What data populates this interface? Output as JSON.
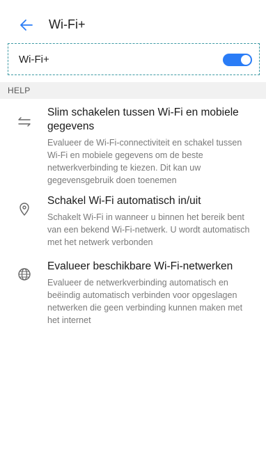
{
  "app_bar": {
    "title": "Wi-Fi+",
    "back_icon": "arrow-left-icon",
    "accent_color": "#2a7cf6"
  },
  "toggle": {
    "label": "Wi-Fi+",
    "state": "on"
  },
  "section": {
    "header": "HELP"
  },
  "help_items": [
    {
      "icon": "switch-arrows-icon",
      "title": "Slim schakelen tussen Wi-Fi en mobiele gegevens",
      "description": "Evalueer de Wi-Fi-connectiviteit en schakel tussen Wi-Fi en mobiele gegevens om de beste netwerkverbinding te kiezen. Dit kan uw gegevensgebruik doen toenemen"
    },
    {
      "icon": "location-pin-icon",
      "title": "Schakel Wi-Fi automatisch in/uit",
      "description": "Schakelt Wi-Fi in wanneer u binnen het bereik bent van een bekend Wi-Fi-netwerk. U wordt automatisch met het netwerk verbonden"
    },
    {
      "icon": "globe-icon",
      "title": "Evalueer beschikbare Wi-Fi-netwerken",
      "description": "Evalueer de netwerkverbinding automatisch en beëindig automatisch verbinden voor opgeslagen netwerken die geen verbinding kunnen maken met het internet"
    }
  ]
}
